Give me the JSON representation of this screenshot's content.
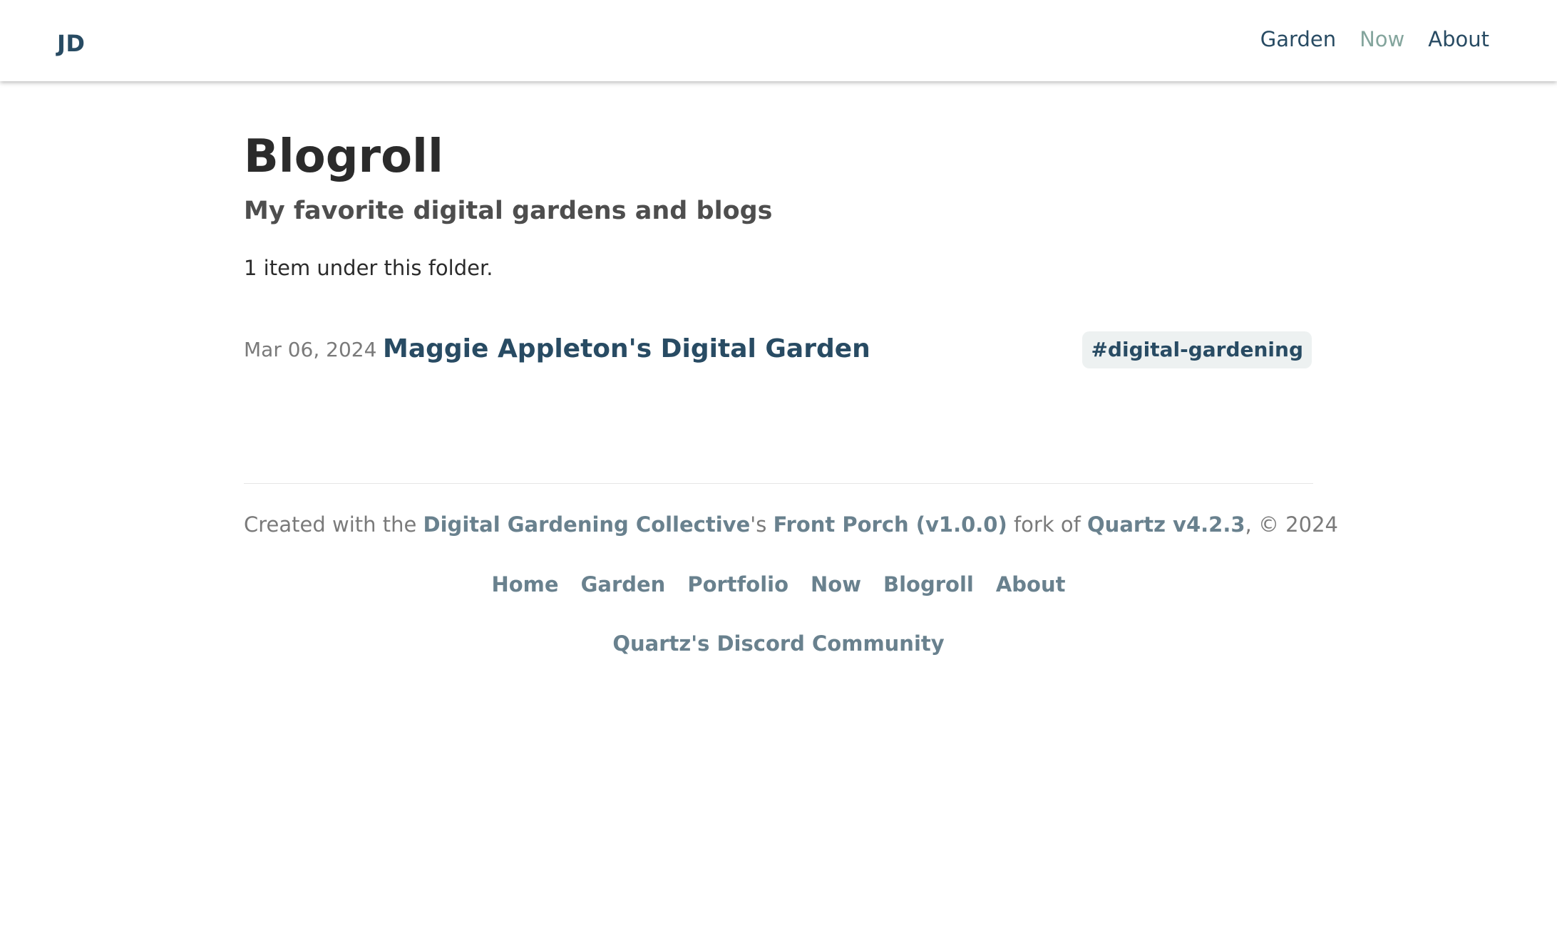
{
  "header": {
    "logo": "JD",
    "nav": [
      {
        "label": "Garden",
        "active": false
      },
      {
        "label": "Now",
        "active": true
      },
      {
        "label": "About",
        "active": false
      }
    ]
  },
  "main": {
    "title": "Blogroll",
    "subtitle": "My favorite digital gardens and blogs",
    "folder_count": "1 item under this folder.",
    "entries": [
      {
        "date": "Mar 06, 2024",
        "title": "Maggie Appleton's Digital Garden",
        "tag": "#digital-gardening"
      }
    ]
  },
  "footer": {
    "credit": {
      "prefix": "Created with the ",
      "collective_link": "Digital Gardening Collective",
      "possessive": "'s ",
      "porch_link": "Front Porch (v1.0.0)",
      "fork_of": " fork of ",
      "quartz_link": "Quartz v4.2.3",
      "suffix": ", © 2024"
    },
    "links": [
      "Home",
      "Garden",
      "Portfolio",
      "Now",
      "Blogroll",
      "About"
    ],
    "discord": "Quartz's Discord Community"
  },
  "colors": {
    "link": "#284b63",
    "active_nav": "#84a59d",
    "footer_link": "#69818e",
    "muted_text": "#7a7a7a",
    "tag_bg": "#edf1f1"
  }
}
